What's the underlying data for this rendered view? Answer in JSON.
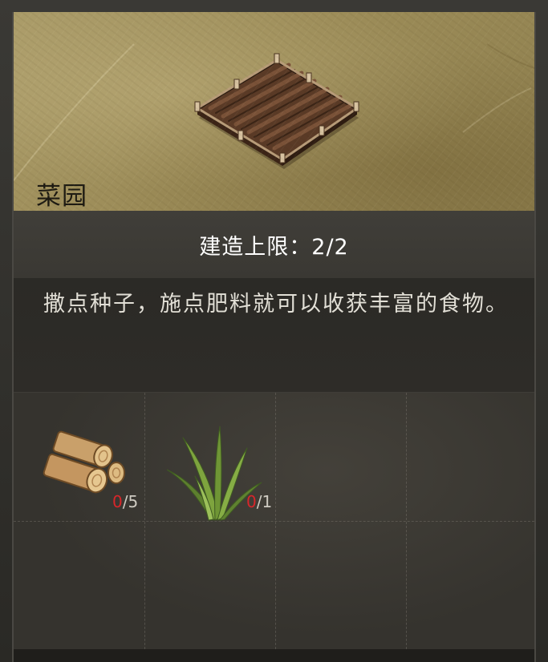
{
  "building": {
    "name": "菜园",
    "image_icon": "vegetable-garden-plot-icon"
  },
  "build_limit": {
    "text": "建造上限：2/2"
  },
  "description": {
    "text": "撒点种子，施点肥料就可以收获丰富的食物。"
  },
  "materials": [
    {
      "icon": "wood-logs-icon",
      "have": "0",
      "need": "/5"
    },
    {
      "icon": "grass-fiber-icon",
      "have": "0",
      "need": "/1"
    }
  ],
  "colors": {
    "required_missing": "#d8262a",
    "parchment": "#a99a67",
    "panel": "#34322c"
  }
}
